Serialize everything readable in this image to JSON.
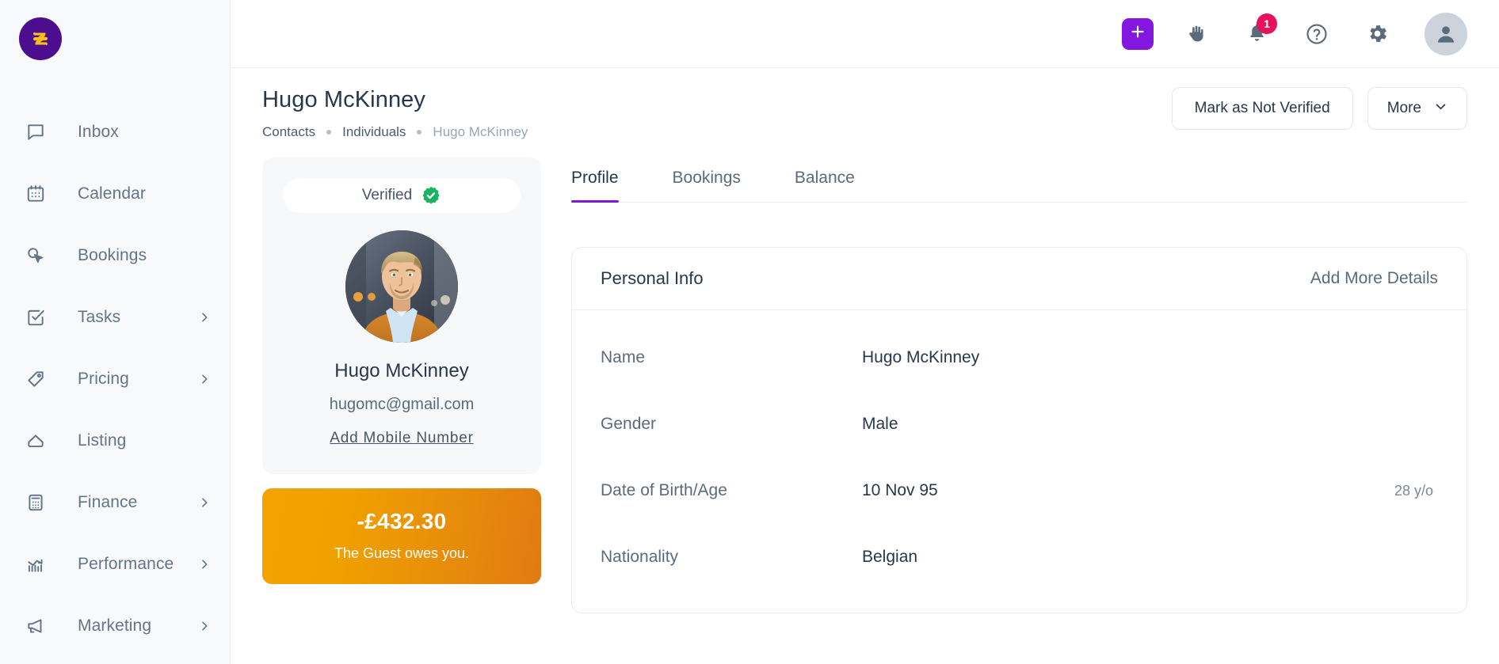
{
  "brand": {
    "logo_icon": "zeevou-z-logo",
    "logo_bg": "#4c0d8f",
    "logo_mark": "#f9bf16"
  },
  "sidebar": {
    "items": [
      {
        "label": "Inbox",
        "icon": "chat-bubble-icon",
        "chevron": false
      },
      {
        "label": "Calendar",
        "icon": "calendar-icon",
        "chevron": false
      },
      {
        "label": "Bookings",
        "icon": "cursor-click-icon",
        "chevron": false
      },
      {
        "label": "Tasks",
        "icon": "checkbox-icon",
        "chevron": true
      },
      {
        "label": "Pricing",
        "icon": "price-tag-icon",
        "chevron": true
      },
      {
        "label": "Listing",
        "icon": "house-icon",
        "chevron": false
      },
      {
        "label": "Finance",
        "icon": "calculator-icon",
        "chevron": true
      },
      {
        "label": "Performance",
        "icon": "chart-growth-icon",
        "chevron": true
      },
      {
        "label": "Marketing",
        "icon": "megaphone-icon",
        "chevron": true
      }
    ]
  },
  "topbar": {
    "add_icon": "plus-icon",
    "hand_icon": "hand-icon",
    "bell_icon": "bell-icon",
    "notification_count": "1",
    "help_icon": "question-mark-circle-icon",
    "settings_icon": "gear-icon",
    "avatar_icon": "user-avatar-icon",
    "accent_purple": "#8317e0",
    "badge_color": "#e8115b"
  },
  "header": {
    "title": "Hugo McKinney",
    "breadcrumb": [
      {
        "label": "Contacts"
      },
      {
        "label": "Individuals"
      },
      {
        "label": "Hugo McKinney"
      }
    ],
    "mark_not_verified_label": "Mark as Not Verified",
    "more_label": "More",
    "more_icon": "chevron-down-icon"
  },
  "profile_card": {
    "verified_label": "Verified",
    "verified_icon": "verified-check-badge-icon",
    "verified_color": "#18b462",
    "avatar_alt": "photo-of-hugo-mckinney",
    "name": "Hugo McKinney",
    "email": "hugomc@gmail.com",
    "add_mobile_label": "Add Mobile Number"
  },
  "balance_card": {
    "amount": "-£432.30",
    "note": "The Guest owes you.",
    "gradient_from": "#f5a200",
    "gradient_to": "#e07b13"
  },
  "tabs": [
    {
      "label": "Profile",
      "active": true
    },
    {
      "label": "Bookings",
      "active": false
    },
    {
      "label": "Balance",
      "active": false
    }
  ],
  "tab_accent": "#7d19d6",
  "personal_info": {
    "title": "Personal Info",
    "action_label": "Add More Details",
    "rows": [
      {
        "label": "Name",
        "value": "Hugo McKinney",
        "extra": ""
      },
      {
        "label": "Gender",
        "value": "Male",
        "extra": ""
      },
      {
        "label": "Date of Birth/Age",
        "value": "10 Nov 95",
        "extra": "28 y/o"
      },
      {
        "label": "Nationality",
        "value": "Belgian",
        "extra": ""
      }
    ]
  }
}
